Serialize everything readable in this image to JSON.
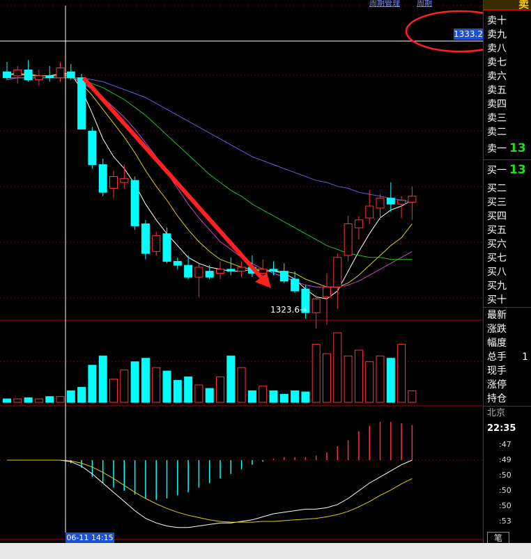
{
  "top_nav": {
    "link1": "周期管理",
    "link2": "周期"
  },
  "crosshair": {
    "price_label": "1333.2",
    "time_label": "06-11 14:15"
  },
  "annotation": {
    "low_label": "1323.6→"
  },
  "colors": {
    "up": "#ff3333",
    "down": "#00ffff",
    "ma_white": "#ffffff",
    "ma_yellow": "#e0d000",
    "ma_magenta": "#d040d0",
    "ma_green": "#20c020",
    "ma_blue": "#6060e0",
    "arrow": "#ff2020",
    "grid": "#7a0000",
    "highlight_circle": "#ff2020"
  },
  "order_book": {
    "header": "卖",
    "sell": [
      "卖十",
      "卖九",
      "卖八",
      "卖七",
      "卖六",
      "卖五",
      "卖四",
      "卖三",
      "卖二",
      "卖一"
    ],
    "sell1_value": "13",
    "buy": [
      "买一",
      "买二",
      "买三",
      "买四",
      "买五",
      "买六",
      "买七",
      "买八",
      "买九",
      "买十"
    ],
    "buy1_value": "13"
  },
  "quote_fields": [
    "最新",
    "涨跌",
    "幅度",
    "总手",
    "现手",
    "涨停",
    "持仓"
  ],
  "quote_values": [
    "",
    "",
    "",
    "1",
    "",
    "",
    ""
  ],
  "tick": {
    "city": "北京",
    "time": "22:35",
    "rows": [
      ":47",
      ":49",
      ":50",
      ":50",
      ":50",
      ":53"
    ]
  },
  "tab_label": "笔",
  "chart_data": {
    "type": "candlestick",
    "ylim": [
      1322.0,
      1336.0
    ],
    "candles": [
      {
        "o": 1334.3,
        "h": 1334.8,
        "l": 1333.9,
        "c": 1334.0
      },
      {
        "o": 1334.1,
        "h": 1334.6,
        "l": 1333.7,
        "c": 1334.4
      },
      {
        "o": 1334.4,
        "h": 1334.9,
        "l": 1333.8,
        "c": 1333.9
      },
      {
        "o": 1333.9,
        "h": 1334.4,
        "l": 1333.6,
        "c": 1334.1
      },
      {
        "o": 1334.1,
        "h": 1334.6,
        "l": 1333.8,
        "c": 1334.0
      },
      {
        "o": 1334.0,
        "h": 1334.8,
        "l": 1333.8,
        "c": 1334.5
      },
      {
        "o": 1334.3,
        "h": 1334.7,
        "l": 1333.9,
        "c": 1334.0
      },
      {
        "o": 1334.0,
        "h": 1334.2,
        "l": 1331.4,
        "c": 1331.4
      },
      {
        "o": 1331.3,
        "h": 1331.5,
        "l": 1329.4,
        "c": 1329.6
      },
      {
        "o": 1329.6,
        "h": 1329.9,
        "l": 1328.0,
        "c": 1328.2
      },
      {
        "o": 1328.4,
        "h": 1329.3,
        "l": 1327.9,
        "c": 1329.0
      },
      {
        "o": 1328.7,
        "h": 1329.6,
        "l": 1328.4,
        "c": 1328.9
      },
      {
        "o": 1328.8,
        "h": 1329.0,
        "l": 1326.3,
        "c": 1326.5
      },
      {
        "o": 1326.6,
        "h": 1326.8,
        "l": 1324.8,
        "c": 1325.1
      },
      {
        "o": 1325.2,
        "h": 1326.2,
        "l": 1325.0,
        "c": 1326.0
      },
      {
        "o": 1326.1,
        "h": 1326.4,
        "l": 1324.6,
        "c": 1324.7
      },
      {
        "o": 1324.7,
        "h": 1324.9,
        "l": 1324.3,
        "c": 1324.5
      },
      {
        "o": 1324.5,
        "h": 1325.0,
        "l": 1323.8,
        "c": 1323.9
      },
      {
        "o": 1323.9,
        "h": 1324.6,
        "l": 1322.9,
        "c": 1324.4
      },
      {
        "o": 1324.2,
        "h": 1324.5,
        "l": 1323.8,
        "c": 1323.9
      },
      {
        "o": 1324.1,
        "h": 1324.7,
        "l": 1323.8,
        "c": 1324.3
      },
      {
        "o": 1324.3,
        "h": 1324.9,
        "l": 1324.0,
        "c": 1324.2
      },
      {
        "o": 1324.2,
        "h": 1324.7,
        "l": 1323.9,
        "c": 1324.4
      },
      {
        "o": 1324.4,
        "h": 1325.0,
        "l": 1323.9,
        "c": 1324.1
      },
      {
        "o": 1324.1,
        "h": 1324.8,
        "l": 1323.9,
        "c": 1324.3
      },
      {
        "o": 1324.3,
        "h": 1324.7,
        "l": 1324.0,
        "c": 1324.2
      },
      {
        "o": 1324.2,
        "h": 1324.6,
        "l": 1323.6,
        "c": 1323.7
      },
      {
        "o": 1323.8,
        "h": 1324.2,
        "l": 1323.1,
        "c": 1323.2
      },
      {
        "o": 1323.3,
        "h": 1323.5,
        "l": 1321.8,
        "c": 1322.1
      },
      {
        "o": 1322.1,
        "h": 1323.0,
        "l": 1321.3,
        "c": 1322.8
      },
      {
        "o": 1322.9,
        "h": 1324.1,
        "l": 1321.5,
        "c": 1323.4
      },
      {
        "o": 1323.4,
        "h": 1325.1,
        "l": 1322.3,
        "c": 1324.9
      },
      {
        "o": 1325.0,
        "h": 1327.0,
        "l": 1324.7,
        "c": 1326.6
      },
      {
        "o": 1326.4,
        "h": 1327.0,
        "l": 1325.8,
        "c": 1326.8
      },
      {
        "o": 1326.9,
        "h": 1328.3,
        "l": 1326.6,
        "c": 1327.5
      },
      {
        "o": 1327.4,
        "h": 1328.1,
        "l": 1326.8,
        "c": 1327.9
      },
      {
        "o": 1327.9,
        "h": 1328.7,
        "l": 1327.2,
        "c": 1327.6
      },
      {
        "o": 1327.6,
        "h": 1328.0,
        "l": 1326.9,
        "c": 1327.8
      },
      {
        "o": 1327.7,
        "h": 1328.5,
        "l": 1326.8,
        "c": 1328.0
      }
    ],
    "volume": [
      3,
      3,
      4,
      3,
      5,
      5,
      10,
      13,
      32,
      40,
      20,
      28,
      35,
      38,
      30,
      27,
      19,
      22,
      15,
      12,
      22,
      40,
      30,
      10,
      14,
      10,
      7,
      10,
      9,
      50,
      42,
      60,
      40,
      45,
      35,
      40,
      38,
      50,
      10
    ],
    "ma_lines": [
      {
        "name": "white",
        "values": [
          1334.2,
          1334.2,
          1334.1,
          1334.1,
          1334.1,
          1334.2,
          1334.2,
          1333.4,
          1332.2,
          1330.9,
          1330.0,
          1329.4,
          1328.6,
          1327.6,
          1326.8,
          1326.1,
          1325.5,
          1324.9,
          1324.6,
          1324.4,
          1324.3,
          1324.2,
          1324.2,
          1324.3,
          1324.2,
          1324.2,
          1324.1,
          1323.8,
          1323.3,
          1322.9,
          1322.8,
          1323.2,
          1324.2,
          1325.2,
          1326.1,
          1326.9,
          1327.3,
          1327.5,
          1327.8
        ]
      },
      {
        "name": "yellow",
        "values": [
          1334.1,
          1334.2,
          1334.2,
          1334.1,
          1334.1,
          1334.1,
          1334.1,
          1333.7,
          1333.1,
          1332.4,
          1331.7,
          1331.0,
          1330.2,
          1329.3,
          1328.5,
          1327.8,
          1327.0,
          1326.3,
          1325.7,
          1325.2,
          1324.8,
          1324.6,
          1324.4,
          1324.3,
          1324.3,
          1324.2,
          1324.2,
          1324.1,
          1323.8,
          1323.6,
          1323.4,
          1323.4,
          1323.6,
          1324.0,
          1324.5,
          1325.0,
          1325.5,
          1325.9,
          1326.6
        ]
      },
      {
        "name": "magenta",
        "values": [
          1333.9,
          1334.0,
          1334.0,
          1334.0,
          1334.0,
          1334.0,
          1334.0,
          1333.8,
          1333.4,
          1333.0,
          1332.5,
          1332.0,
          1331.4,
          1330.7,
          1330.0,
          1329.2,
          1328.4,
          1327.6,
          1326.9,
          1326.3,
          1325.7,
          1325.3,
          1324.9,
          1324.6,
          1324.3,
          1324.1,
          1323.9,
          1323.7,
          1323.5,
          1323.4,
          1323.4,
          1323.4,
          1323.5,
          1323.7,
          1324.0,
          1324.3,
          1324.6,
          1324.9,
          1325.2
        ]
      },
      {
        "name": "green",
        "values": [
          1334.0,
          1334.0,
          1334.0,
          1334.0,
          1334.0,
          1334.0,
          1334.0,
          1333.9,
          1333.7,
          1333.5,
          1333.2,
          1332.9,
          1332.5,
          1332.1,
          1331.6,
          1331.1,
          1330.6,
          1330.1,
          1329.6,
          1329.1,
          1328.7,
          1328.3,
          1328.0,
          1327.6,
          1327.3,
          1327.0,
          1326.7,
          1326.4,
          1326.1,
          1325.8,
          1325.5,
          1325.3,
          1325.1,
          1325.0,
          1324.9,
          1324.9,
          1324.8,
          1324.8,
          1324.8
        ]
      },
      {
        "name": "blue",
        "values": [
          1334.0,
          1334.0,
          1334.0,
          1334.0,
          1334.0,
          1334.0,
          1334.0,
          1334.0,
          1333.9,
          1333.8,
          1333.6,
          1333.4,
          1333.2,
          1333.0,
          1332.7,
          1332.4,
          1332.1,
          1331.8,
          1331.5,
          1331.2,
          1330.9,
          1330.6,
          1330.3,
          1330.0,
          1329.8,
          1329.6,
          1329.4,
          1329.2,
          1329.0,
          1328.8,
          1328.7,
          1328.5,
          1328.4,
          1328.2,
          1328.1,
          1328.0,
          1327.9,
          1327.8,
          1327.7
        ]
      }
    ],
    "macd": [
      0,
      0,
      0,
      0,
      0,
      0,
      -4,
      -10,
      -22,
      -30,
      -36,
      -40,
      -45,
      -50,
      -52,
      -50,
      -46,
      -42,
      -36,
      -30,
      -24,
      -18,
      -12,
      -6,
      -2,
      2,
      4,
      4,
      4,
      6,
      10,
      18,
      26,
      38,
      45,
      50,
      50,
      48,
      46
    ],
    "macd_white": [
      0,
      0,
      0,
      0,
      0,
      0,
      -2,
      -8,
      -18,
      -30,
      -42,
      -54,
      -66,
      -76,
      -82,
      -86,
      -88,
      -88,
      -86,
      -84,
      -82,
      -82,
      -80,
      -78,
      -74,
      -70,
      -68,
      -66,
      -64,
      -64,
      -62,
      -58,
      -50,
      -40,
      -30,
      -22,
      -14,
      -6,
      0
    ],
    "macd_yellow": [
      0,
      0,
      0,
      0,
      0,
      0,
      -1,
      -4,
      -9,
      -16,
      -24,
      -33,
      -42,
      -50,
      -57,
      -63,
      -68,
      -72,
      -75,
      -78,
      -80,
      -81,
      -81,
      -81,
      -80,
      -80,
      -79,
      -78,
      -77,
      -76,
      -74,
      -71,
      -67,
      -61,
      -54,
      -46,
      -39,
      -31,
      -24
    ]
  }
}
